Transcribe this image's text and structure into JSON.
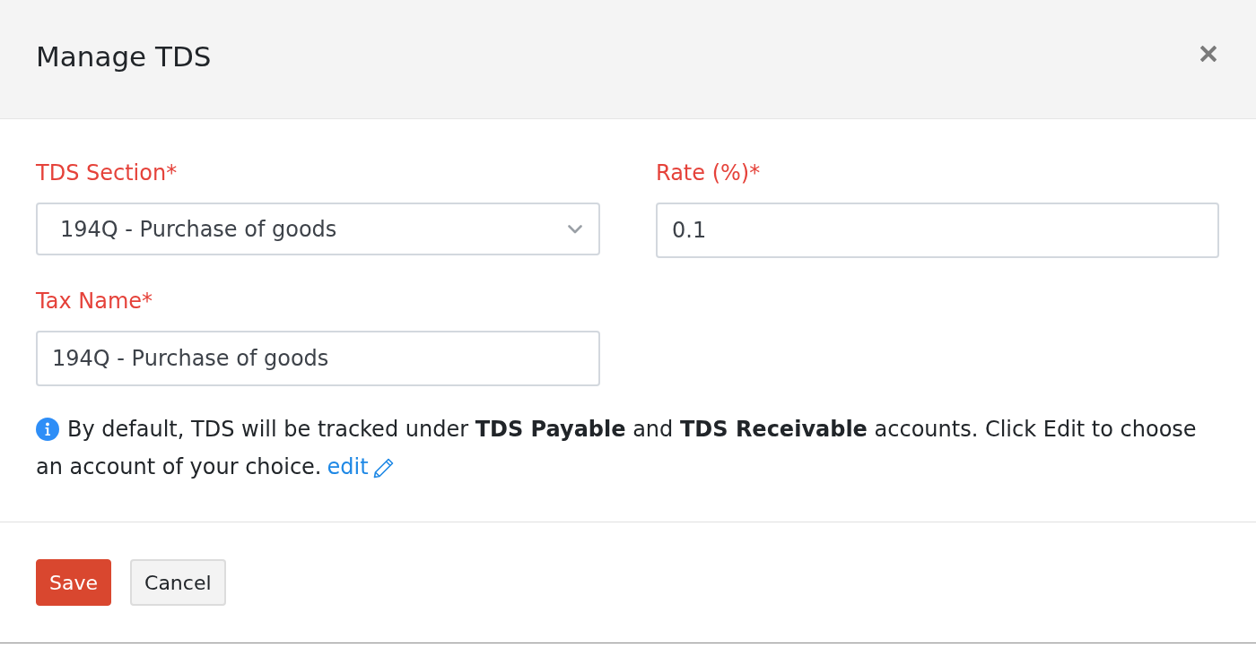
{
  "dialog": {
    "title": "Manage TDS"
  },
  "fields": [
    {
      "kind": "select",
      "label": "TDS Section*",
      "value": "194Q - Purchase of goods"
    },
    {
      "kind": "input",
      "label": "Rate (%)*",
      "value": "0.1"
    },
    {
      "kind": "input",
      "label": "Tax Name*",
      "value": "194Q - Purchase of goods"
    }
  ],
  "note": {
    "text": "By default, TDS will be tracked under **TDS Payable** and **TDS Receivable** accounts. Click Edit to choose an account of your choice.",
    "link": "edit"
  },
  "buttons": [
    {
      "kind": "primary",
      "label": "Save"
    },
    {
      "kind": "secondary",
      "label": "Cancel"
    }
  ]
}
